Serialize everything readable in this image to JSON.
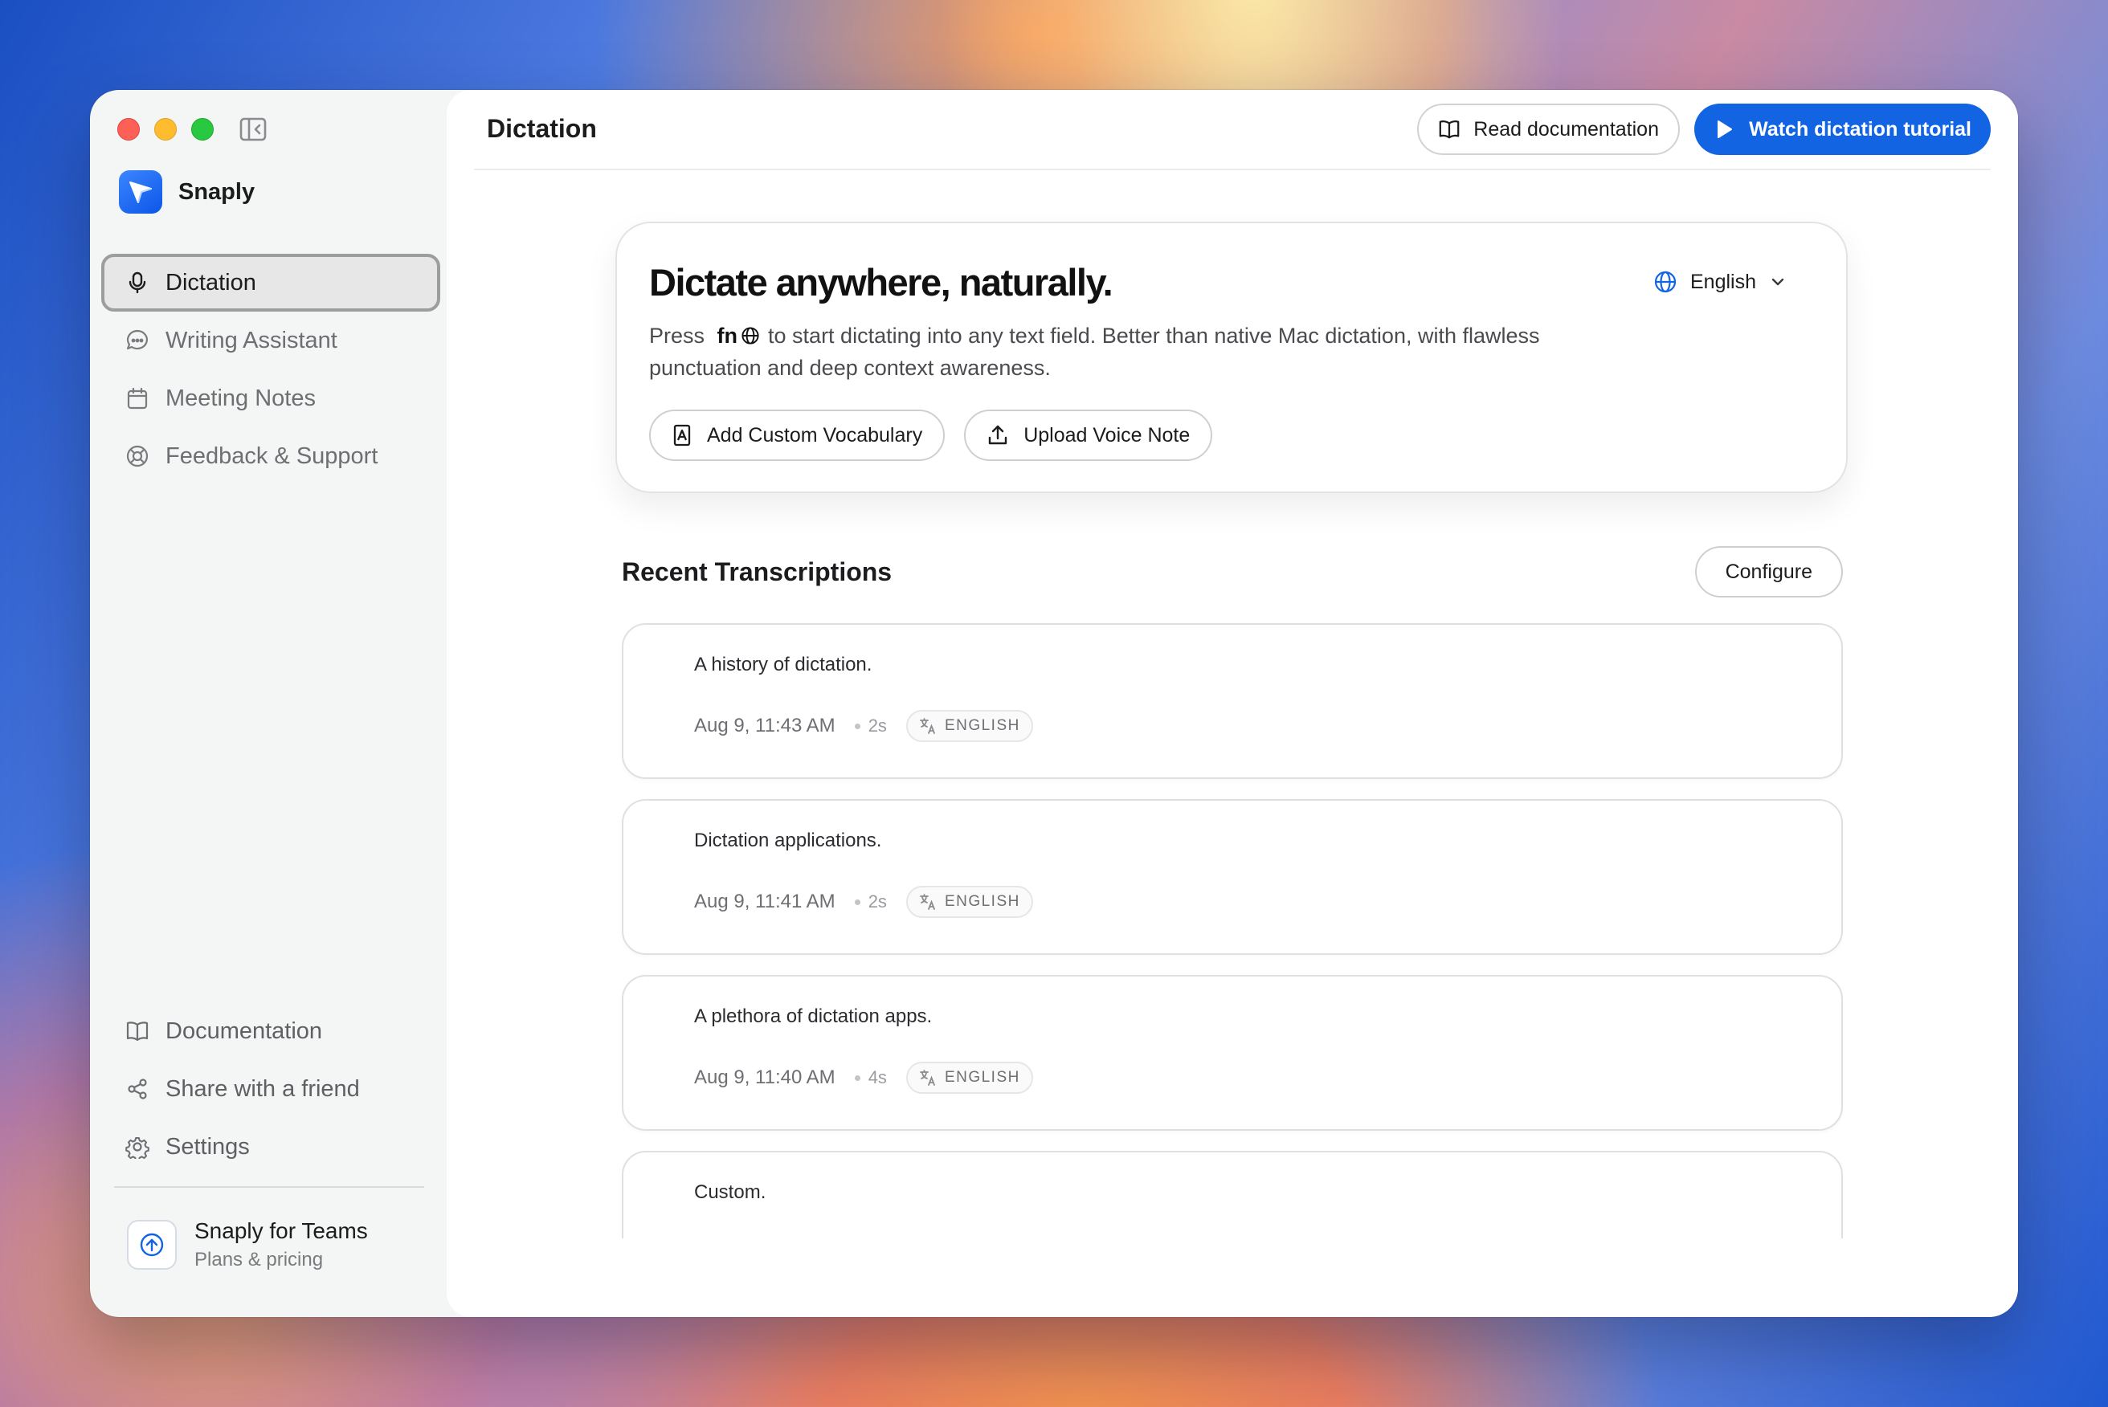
{
  "window": {
    "sidebar_toggle_icon": "sidebar-toggle-icon"
  },
  "brand": {
    "name": "Snaply",
    "logo_color": "#1264e2"
  },
  "sidebar": {
    "items": [
      {
        "label": "Dictation",
        "icon": "microphone-icon",
        "active": true
      },
      {
        "label": "Writing Assistant",
        "icon": "chat-bubble-icon"
      },
      {
        "label": "Meeting Notes",
        "icon": "calendar-icon"
      },
      {
        "label": "Feedback & Support",
        "icon": "lifebuoy-icon"
      }
    ],
    "bottom_items": [
      {
        "label": "Documentation",
        "icon": "book-icon"
      },
      {
        "label": "Share with a friend",
        "icon": "share-icon"
      },
      {
        "label": "Settings",
        "icon": "gear-icon"
      }
    ],
    "teams": {
      "title": "Snaply for Teams",
      "subtitle": "Plans & pricing"
    }
  },
  "header": {
    "title": "Dictation",
    "read_docs_label": "Read documentation",
    "watch_tutorial_label": "Watch dictation tutorial",
    "accent": "#1264e2"
  },
  "hero": {
    "title": "Dictate anywhere, naturally.",
    "language": "English",
    "desc_before": "Press",
    "fn_key": "fn",
    "desc_after": "to start dictating into any text field. Better than native Mac dictation, with flawless punctuation and deep context awareness.",
    "add_vocab_label": "Add Custom Vocabulary",
    "upload_label": "Upload Voice Note"
  },
  "transcriptions": {
    "title": "Recent Transcriptions",
    "configure_label": "Configure",
    "items": [
      {
        "text": "A history of dictation.",
        "time": "Aug 9, 11:43 AM",
        "duration": "2s",
        "language": "ENGLISH"
      },
      {
        "text": "Dictation applications.",
        "time": "Aug 9, 11:41 AM",
        "duration": "2s",
        "language": "ENGLISH"
      },
      {
        "text": "A plethora of dictation apps.",
        "time": "Aug 9, 11:40 AM",
        "duration": "4s",
        "language": "ENGLISH"
      },
      {
        "text": "Custom.",
        "time": "",
        "duration": "",
        "language": ""
      }
    ]
  }
}
